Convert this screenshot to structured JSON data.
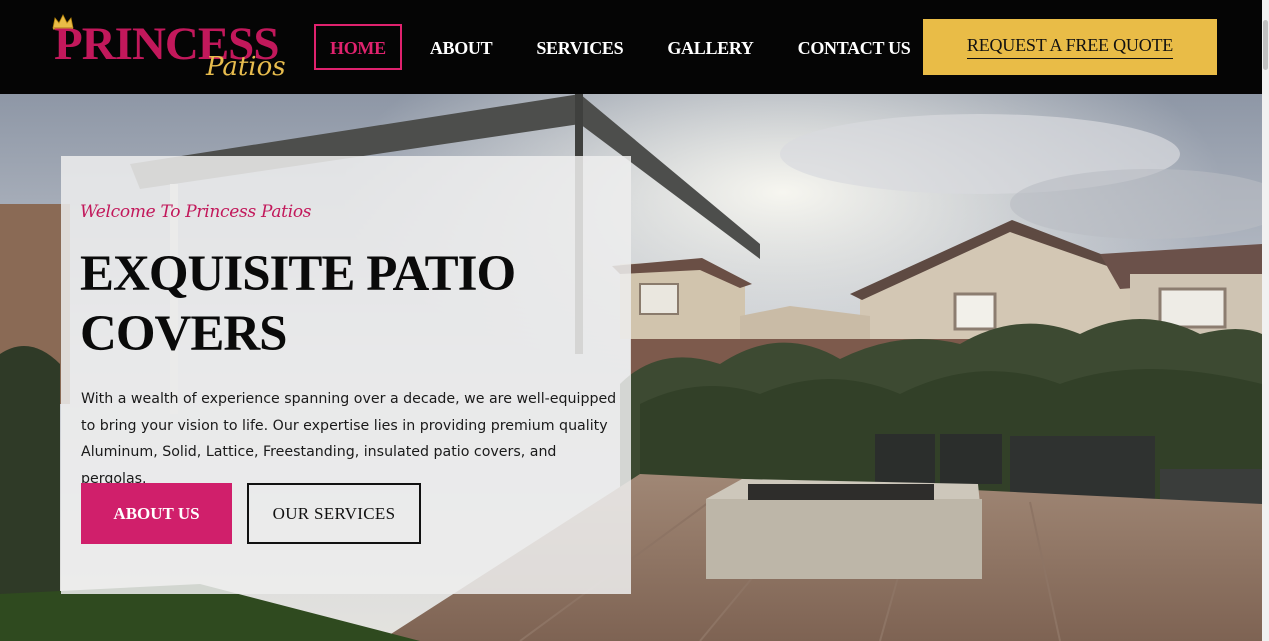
{
  "brand": {
    "name": "PRINCESS",
    "tagline": "Patios",
    "colors": {
      "pink": "#d01f6b",
      "gold": "#e9bc47",
      "header_bg": "#050505"
    }
  },
  "nav": {
    "items": [
      {
        "label": "HOME",
        "active": true
      },
      {
        "label": "ABOUT",
        "active": false
      },
      {
        "label": "SERVICES",
        "active": false
      },
      {
        "label": "GALLERY",
        "active": false
      },
      {
        "label": "CONTACT US",
        "active": false
      }
    ],
    "cta_label": "REQUEST A FREE QUOTE"
  },
  "hero": {
    "welcome": "Welcome To Princess Patios",
    "headline_line1": "EXQUISITE PATIO",
    "headline_line2": "COVERS",
    "description_line1": "With a wealth of experience spanning over a decade, we are well-equipped",
    "description_line2": "to bring your vision to life. Our expertise lies in providing premium quality",
    "description_line3": "Aluminum, Solid, Lattice, Freestanding, insulated patio covers, and pergolas.",
    "primary_button": "ABOUT US",
    "secondary_button": "OUR SERVICES"
  }
}
